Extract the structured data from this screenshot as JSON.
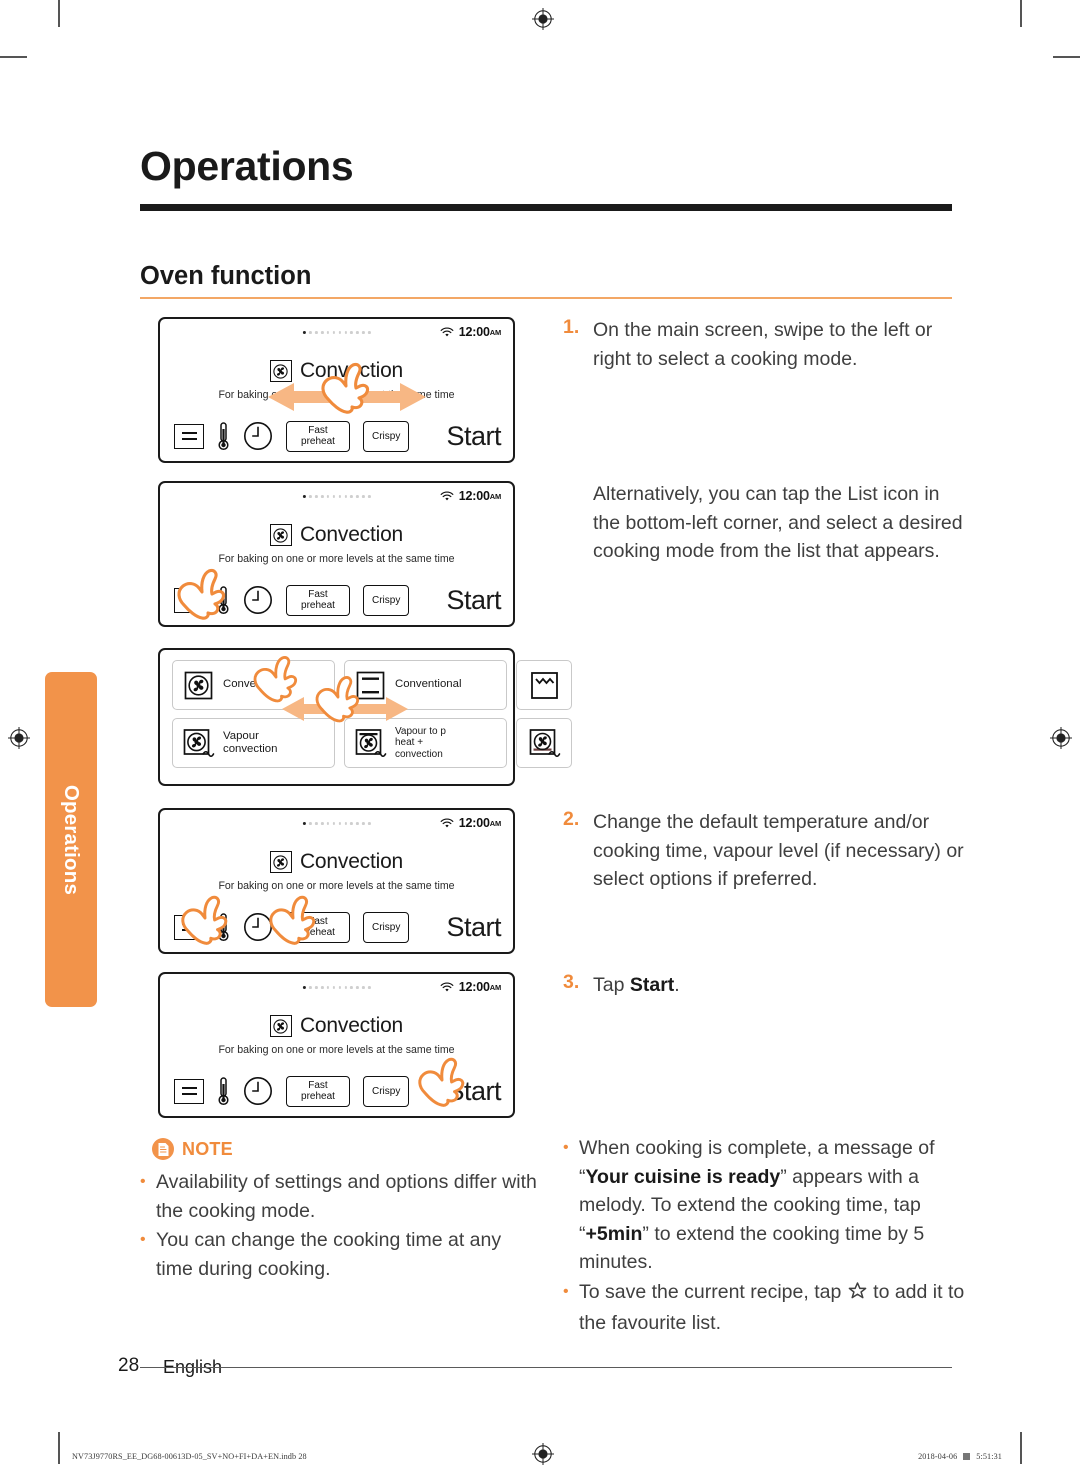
{
  "document": {
    "chapter_title": "Operations",
    "section_title": "Oven function",
    "side_tab_label": "Operations",
    "page_number": "28",
    "page_language": "English",
    "print_code_left": "NV73J9770RS_EE_DG68-00613D-05_SV+NO+FI+DA+EN.indb   28",
    "print_date": "2018-04-06",
    "print_time": "5:51:31"
  },
  "colors": {
    "accent_orange": "#f08b3c",
    "tab_orange": "#f2934a",
    "rule_dark": "#1a1a1a",
    "body_text": "#3f3f3f"
  },
  "oven_screen": {
    "status_time": "12:00",
    "status_meridiem": "AM",
    "wifi_icon": "wifi-icon",
    "mode_icon": "convection-fan-icon",
    "mode_name": "Convection",
    "mode_description": "For baking on one or more levels at the  same time",
    "controls": {
      "list_icon": "list-icon",
      "temperature_icon": "thermometer-icon",
      "timer_icon": "clock-icon",
      "option_fast_preheat": "Fast\npreheat",
      "option_fast_preheat_line1": "Fast",
      "option_fast_preheat_line2": "preheat",
      "option_crispy": "Crispy",
      "start_label": "Start"
    }
  },
  "mode_list": {
    "cells": [
      {
        "label": "Convection",
        "icon": "convection-fan-icon"
      },
      {
        "label": "Vapour convection",
        "label_line1": "Vapour",
        "label_line2": "convection",
        "icon": "vapour-convection-icon"
      },
      {
        "label": "Conventional",
        "icon": "conventional-heat-icon"
      },
      {
        "label": "Vapour to p heat + convection",
        "label_line1": "Vapour to p",
        "label_line2": "heat +",
        "label_line3": "convection",
        "icon": "vapour-convection-icon"
      },
      {
        "label": "",
        "icon": "top-heat-grill-icon"
      },
      {
        "label": "",
        "icon": "vapour-convection-bottom-icon"
      }
    ]
  },
  "instructions": {
    "step1": {
      "number": "1.",
      "text": "On the main screen, swipe to the left or right to select a cooking mode."
    },
    "alternative": "Alternatively, you can tap the List icon in the bottom-left corner, and select a desired cooking mode from the list that appears.",
    "step2": {
      "number": "2.",
      "text": "Change the default temperature and/or cooking time, vapour level (if necessary) or select options if preferred."
    },
    "step3": {
      "number": "3.",
      "prefix": "Tap ",
      "bold": "Start",
      "suffix": "."
    },
    "bullets": [
      {
        "part1": "When cooking is complete, a message of “",
        "bold1": "Your cuisine is ready",
        "part2": "” appears with a melody. To extend the cooking time, tap “",
        "bold2": "+5min",
        "part3": "” to extend the cooking time by 5 minutes."
      },
      {
        "part1": "To save the current recipe, tap ",
        "star_icon": "star-outline-icon",
        "part2": " to add it to the favourite list."
      }
    ]
  },
  "note": {
    "icon": "note-document-icon",
    "label": "NOTE",
    "items": [
      "Availability of settings and options differ with the cooking mode.",
      "You can change the cooking time at any time during cooking."
    ]
  }
}
